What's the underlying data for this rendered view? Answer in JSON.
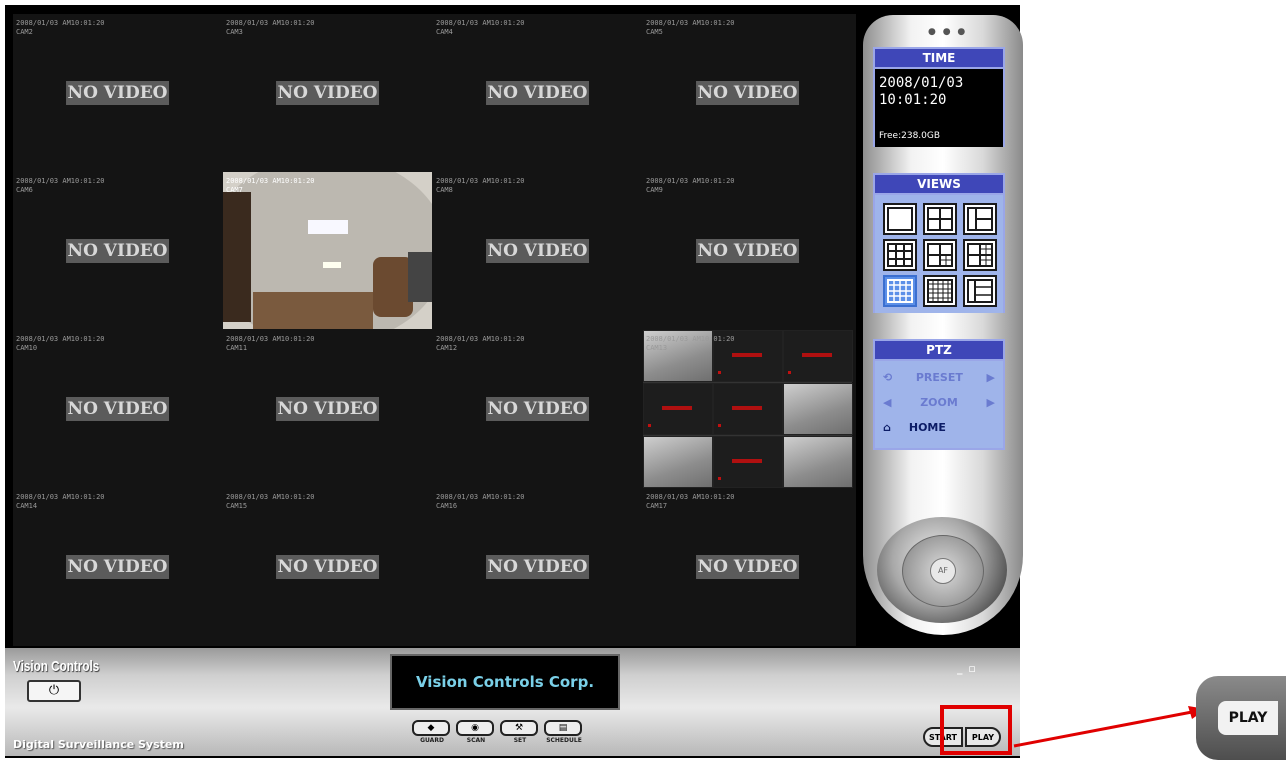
{
  "cams": [
    {
      "stamp": "2008/01/03 AM10:01:20",
      "name": "CAM2",
      "state": "NO VIDEO"
    },
    {
      "stamp": "2008/01/03 AM10:01:20",
      "name": "CAM3",
      "state": "NO VIDEO"
    },
    {
      "stamp": "2008/01/03 AM10:01:20",
      "name": "CAM4",
      "state": "NO VIDEO"
    },
    {
      "stamp": "2008/01/03 AM10:01:20",
      "name": "CAM5",
      "state": "NO VIDEO"
    },
    {
      "stamp": "2008/01/03 AM10:01:20",
      "name": "CAM6",
      "state": "NO VIDEO"
    },
    {
      "stamp": "2008/01/03 AM10:01:20",
      "name": "CAM7",
      "state": ""
    },
    {
      "stamp": "2008/01/03 AM10:01:20",
      "name": "CAM8",
      "state": "NO VIDEO"
    },
    {
      "stamp": "2008/01/03 AM10:01:20",
      "name": "CAM9",
      "state": "NO VIDEO"
    },
    {
      "stamp": "2008/01/03 AM10:01:20",
      "name": "CAM10",
      "state": "NO VIDEO"
    },
    {
      "stamp": "2008/01/03 AM10:01:20",
      "name": "CAM11",
      "state": "NO VIDEO"
    },
    {
      "stamp": "2008/01/03 AM10:01:20",
      "name": "CAM12",
      "state": "NO VIDEO"
    },
    {
      "stamp": "2008/01/03 AM10:01:20",
      "name": "CAM13",
      "state": ""
    },
    {
      "stamp": "2008/01/03 AM10:01:20",
      "name": "CAM14",
      "state": "NO VIDEO"
    },
    {
      "stamp": "2008/01/03 AM10:01:20",
      "name": "CAM15",
      "state": "NO VIDEO"
    },
    {
      "stamp": "2008/01/03 AM10:01:20",
      "name": "CAM16",
      "state": "NO VIDEO"
    },
    {
      "stamp": "2008/01/03 AM10:01:20",
      "name": "CAM17",
      "state": "NO VIDEO"
    }
  ],
  "panel": {
    "time_header": "TIME",
    "date": "2008/01/03",
    "clock": "10:01:20",
    "free": "Free:238.0GB",
    "views_header": "VIEWS",
    "ptz_header": "PTZ",
    "preset": "PRESET",
    "zoom": "ZOOM",
    "home": "HOME",
    "dots": "● ● ●"
  },
  "bottom": {
    "brand": "Vision Controls",
    "corp": "Vision Controls Corp.",
    "tagline": "Digital Surveillance System",
    "guard": "GUARD",
    "scan": "SCAN",
    "set": "SET",
    "schedule": "SCHEDULE",
    "start": "START",
    "play": "PLAY",
    "winctl": "_ ▫"
  },
  "callout": {
    "play": "PLAY"
  },
  "colors": {
    "highlight": "#e00000",
    "ptz_header": "#3f47b8",
    "view_selected": "#5b8fe8"
  }
}
